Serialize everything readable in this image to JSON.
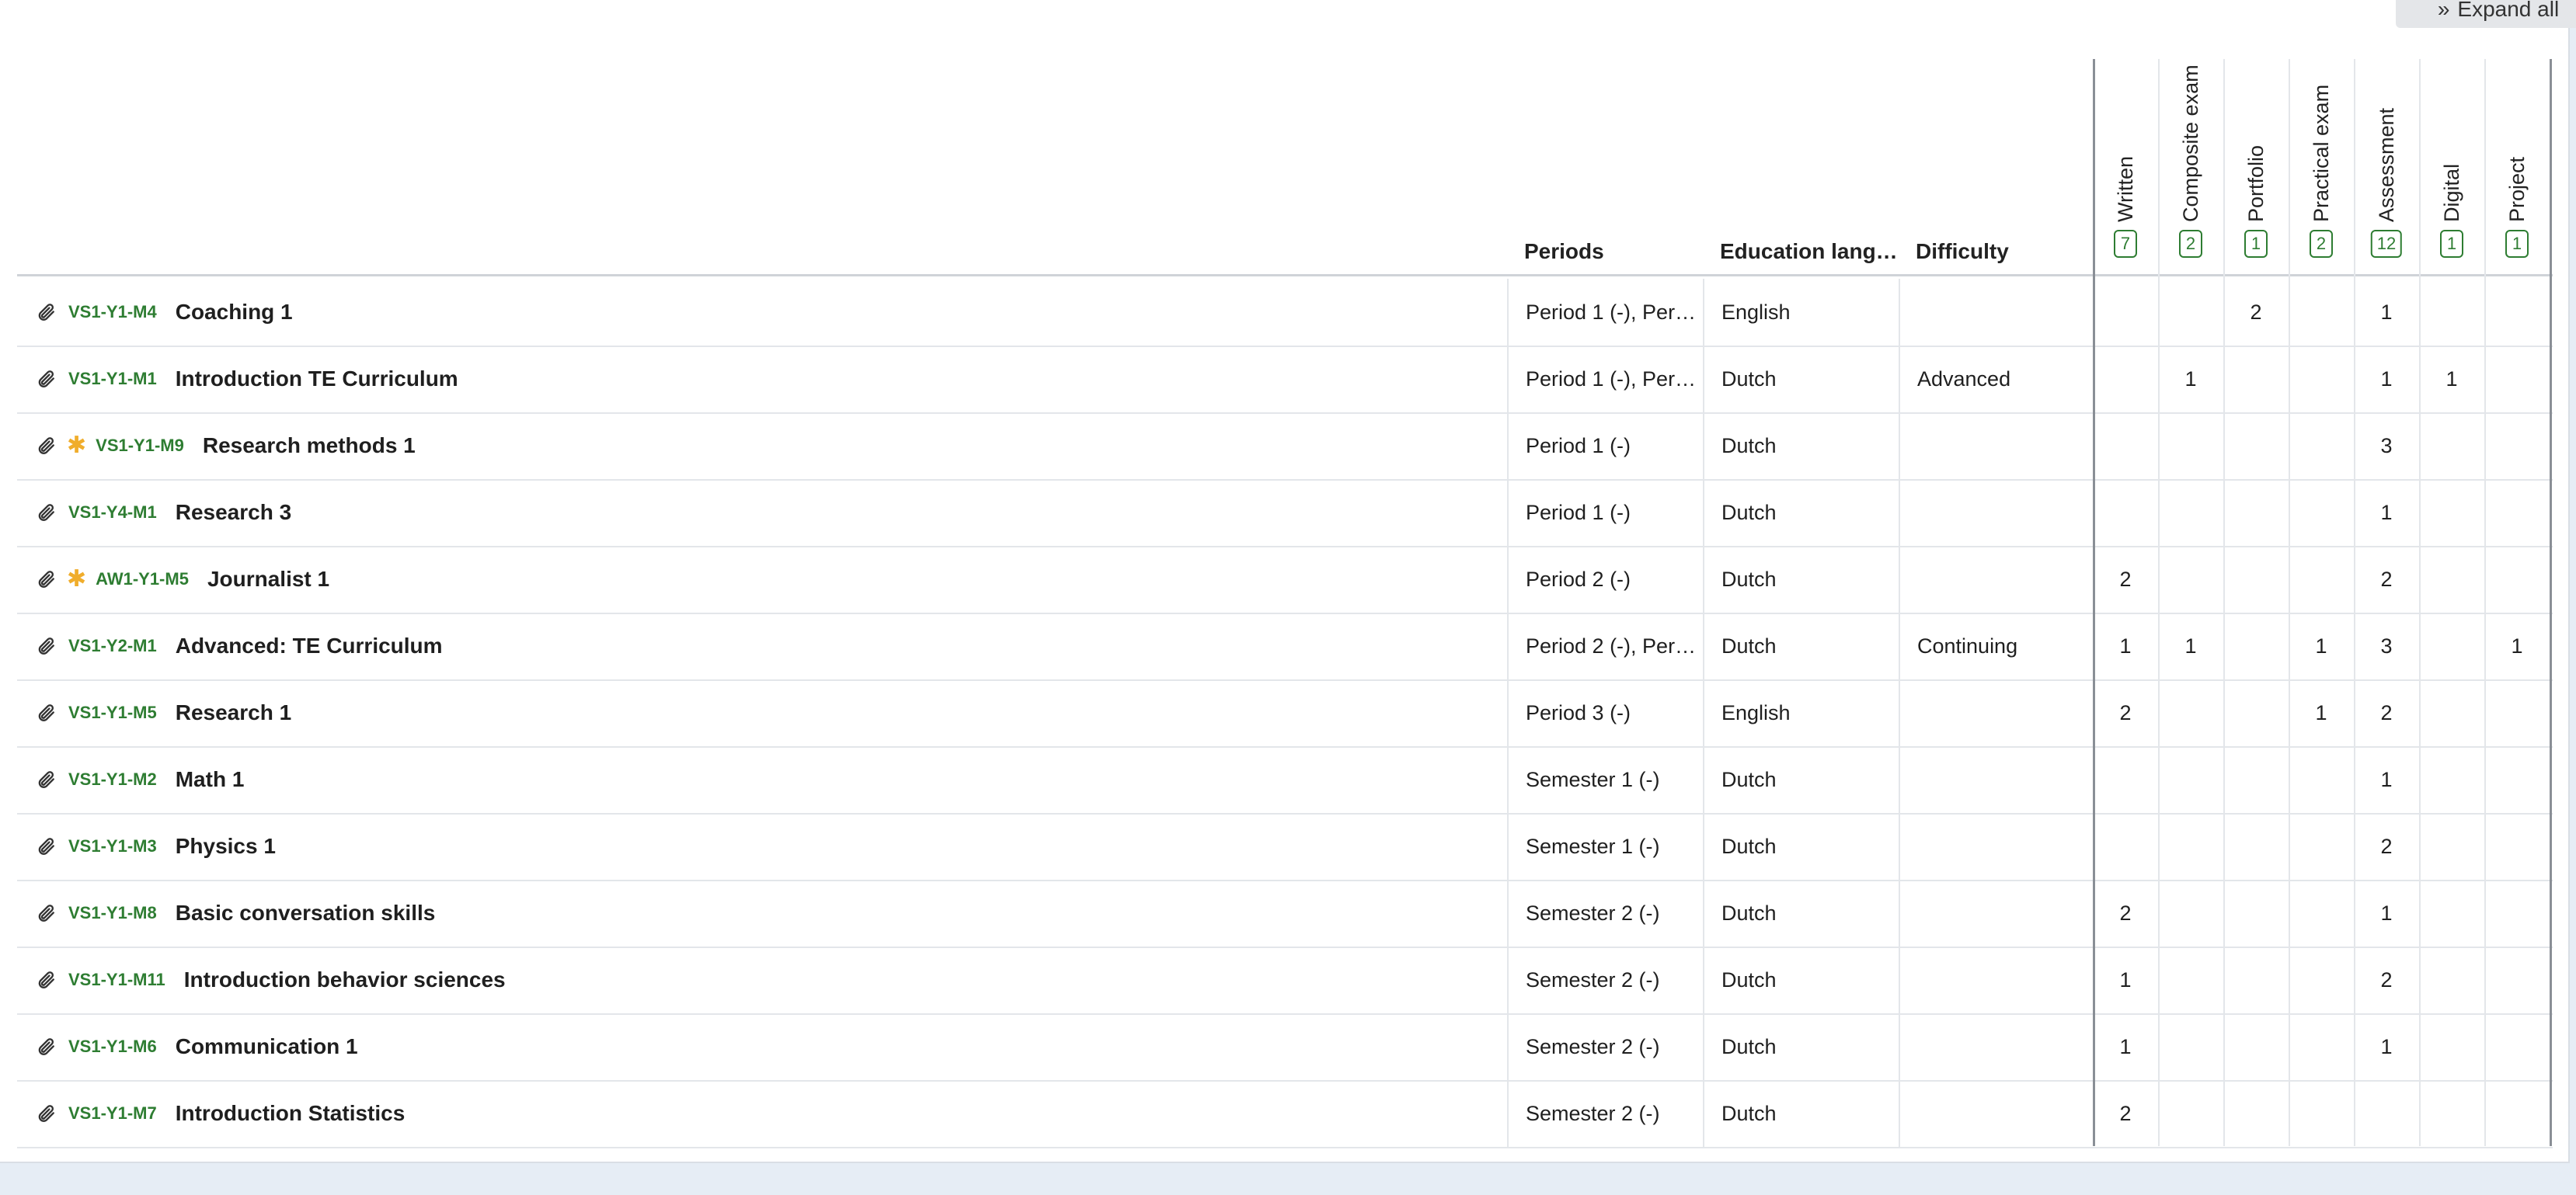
{
  "toolbar": {
    "expand_all_label": "Expand all",
    "expand_icon": "double-chevron-right"
  },
  "columns": {
    "periods": "Periods",
    "education_language": "Education lang…",
    "difficulty": "Difficulty",
    "assessment_types": [
      {
        "label": "Written",
        "count": "7"
      },
      {
        "label": "Composite exam",
        "count": "2"
      },
      {
        "label": "Portfolio",
        "count": "1"
      },
      {
        "label": "Practical exam",
        "count": "2"
      },
      {
        "label": "Assessment",
        "count": "12"
      },
      {
        "label": "Digital",
        "count": "1"
      },
      {
        "label": "Project",
        "count": "1"
      }
    ]
  },
  "rows": [
    {
      "code": "VS1-Y1-M4",
      "name": "Coaching 1",
      "starred": false,
      "periods": "Period 1 (-), Per…",
      "language": "English",
      "difficulty": "",
      "counts": [
        "",
        "",
        "2",
        "",
        "1",
        "",
        ""
      ]
    },
    {
      "code": "VS1-Y1-M1",
      "name": "Introduction TE Curriculum",
      "starred": false,
      "periods": "Period 1 (-), Per…",
      "language": "Dutch",
      "difficulty": "Advanced",
      "counts": [
        "",
        "1",
        "",
        "",
        "1",
        "1",
        ""
      ]
    },
    {
      "code": "VS1-Y1-M9",
      "name": "Research methods 1",
      "starred": true,
      "periods": "Period 1 (-)",
      "language": "Dutch",
      "difficulty": "",
      "counts": [
        "",
        "",
        "",
        "",
        "3",
        "",
        ""
      ]
    },
    {
      "code": "VS1-Y4-M1",
      "name": "Research 3",
      "starred": false,
      "periods": "Period 1 (-)",
      "language": "Dutch",
      "difficulty": "",
      "counts": [
        "",
        "",
        "",
        "",
        "1",
        "",
        ""
      ]
    },
    {
      "code": "AW1-Y1-M5",
      "name": "Journalist 1",
      "starred": true,
      "periods": "Period 2 (-)",
      "language": "Dutch",
      "difficulty": "",
      "counts": [
        "2",
        "",
        "",
        "",
        "2",
        "",
        ""
      ]
    },
    {
      "code": "VS1-Y2-M1",
      "name": "Advanced: TE Curriculum",
      "starred": false,
      "periods": "Period 2 (-), Per…",
      "language": "Dutch",
      "difficulty": "Continuing",
      "counts": [
        "1",
        "1",
        "",
        "1",
        "3",
        "",
        "1"
      ]
    },
    {
      "code": "VS1-Y1-M5",
      "name": "Research 1",
      "starred": false,
      "periods": "Period 3 (-)",
      "language": "English",
      "difficulty": "",
      "counts": [
        "2",
        "",
        "",
        "1",
        "2",
        "",
        ""
      ]
    },
    {
      "code": "VS1-Y1-M2",
      "name": "Math 1",
      "starred": false,
      "periods": "Semester 1 (-)",
      "language": "Dutch",
      "difficulty": "",
      "counts": [
        "",
        "",
        "",
        "",
        "1",
        "",
        ""
      ]
    },
    {
      "code": "VS1-Y1-M3",
      "name": "Physics 1",
      "starred": false,
      "periods": "Semester 1 (-)",
      "language": "Dutch",
      "difficulty": "",
      "counts": [
        "",
        "",
        "",
        "",
        "2",
        "",
        ""
      ]
    },
    {
      "code": "VS1-Y1-M8",
      "name": "Basic conversation skills",
      "starred": false,
      "periods": "Semester 2 (-)",
      "language": "Dutch",
      "difficulty": "",
      "counts": [
        "2",
        "",
        "",
        "",
        "1",
        "",
        ""
      ]
    },
    {
      "code": "VS1-Y1-M11",
      "name": "Introduction behavior sciences",
      "starred": false,
      "periods": "Semester 2 (-)",
      "language": "Dutch",
      "difficulty": "",
      "counts": [
        "1",
        "",
        "",
        "",
        "2",
        "",
        ""
      ]
    },
    {
      "code": "VS1-Y1-M6",
      "name": "Communication 1",
      "starred": false,
      "periods": "Semester 2 (-)",
      "language": "Dutch",
      "difficulty": "",
      "counts": [
        "1",
        "",
        "",
        "",
        "1",
        "",
        ""
      ]
    },
    {
      "code": "VS1-Y1-M7",
      "name": "Introduction Statistics",
      "starred": false,
      "periods": "Semester 2 (-)",
      "language": "Dutch",
      "difficulty": "",
      "counts": [
        "2",
        "",
        "",
        "",
        "",
        "",
        ""
      ]
    }
  ],
  "colors": {
    "code_green": "#2e7d32",
    "star": "#f0ad2c",
    "background": "#e6edf5"
  }
}
